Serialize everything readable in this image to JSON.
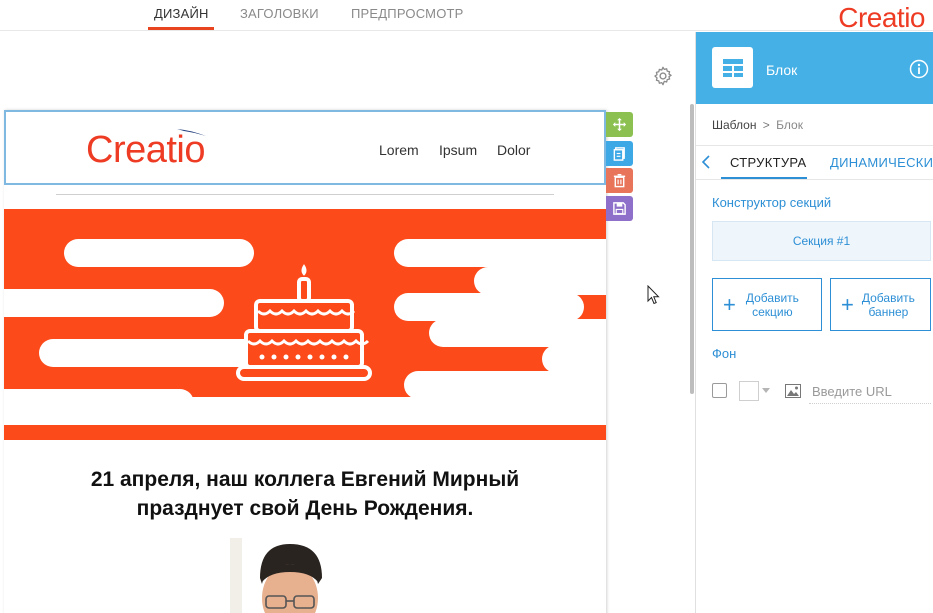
{
  "top_tabs": [
    {
      "label": "ДИЗАЙН",
      "active": true
    },
    {
      "label": "ЗАГОЛОВКИ",
      "active": false
    },
    {
      "label": "ПРЕДПРОСМОТР",
      "active": false
    }
  ],
  "brand": "Creatio",
  "email": {
    "logo": "Creatio",
    "nav": [
      "Lorem",
      "Ipsum",
      "Dolor"
    ],
    "headline_line1": "21 апреля, наш коллега Евгений Мирный",
    "headline_line2": "празднует свой День Рождения."
  },
  "panel": {
    "title": "Блок",
    "breadcrumb": {
      "parent": "Шаблон",
      "separator": ">",
      "current": "Блок"
    },
    "tabs": [
      {
        "label": "СТРУКТУРА",
        "active": true
      },
      {
        "label": "ДИНАМИЧЕСКИ",
        "active": false
      }
    ],
    "section_builder_title": "Конструктор секций",
    "section_item": "Секция #1",
    "add_section": {
      "line1": "Добавить",
      "line2": "секцию"
    },
    "add_banner": {
      "line1": "Добавить",
      "line2": "баннер"
    },
    "background_title": "Фон",
    "url_placeholder": "Введите URL"
  },
  "colors": {
    "accent_orange": "#fc4a1a",
    "brand_red": "#ee3b24",
    "panel_blue": "#45b0e6",
    "link_blue": "#2d8fd5",
    "tool_move": "#8cc152",
    "tool_copy": "#3da8e6",
    "tool_delete": "#e8745a",
    "tool_save": "#8e6fc9"
  }
}
